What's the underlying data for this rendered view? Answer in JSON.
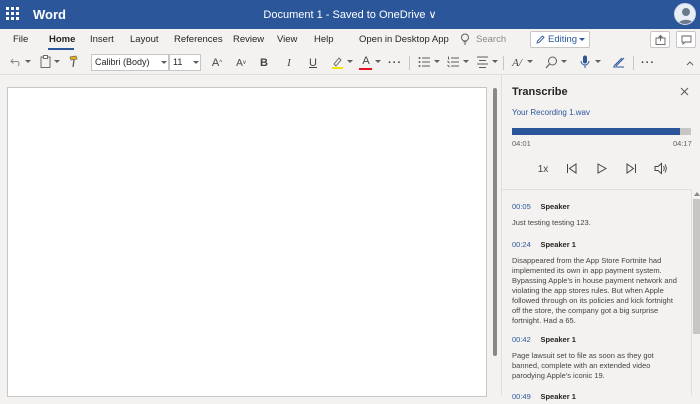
{
  "app": {
    "name": "Word",
    "doc_title": "Document 1 - Saved to OneDrive ∨"
  },
  "menu": {
    "items": [
      "File",
      "Home",
      "Insert",
      "Layout",
      "References",
      "Review",
      "View",
      "Help",
      "Open in Desktop App"
    ],
    "active": "Home",
    "search_label": "Search",
    "editing_label": "Editing"
  },
  "ribbon": {
    "font_name": "Calibri (Body)",
    "font_size": "11",
    "highlight_color": "#f2e600",
    "font_color": "#e81123"
  },
  "transcribe": {
    "title": "Transcribe",
    "file_name": "Your Recording 1.wav",
    "current_time": "04:01",
    "total_time": "04:17",
    "progress": 0.94,
    "speed_label": "1x",
    "entries": [
      {
        "time": "00:05",
        "speaker": "Speaker",
        "text": "Just testing testing 123."
      },
      {
        "time": "00:24",
        "speaker": "Speaker 1",
        "text": "Disappeared from the App Store Fortnite had implemented its own in app payment system. Bypassing Apple's in house payment network and violating the app stores rules. But when Apple followed through on its policies and kick fortnight off the store, the company got a big surprise fortnight. Had a 65."
      },
      {
        "time": "00:42",
        "speaker": "Speaker 1",
        "text": "Page lawsuit set to file as soon as they got banned, complete with an extended video parodying Apple's iconic 19."
      },
      {
        "time": "00:49",
        "speaker": "Speaker 1",
        "text": ""
      }
    ]
  },
  "colors": {
    "brand": "#2b579a",
    "panel_bg": "#f3f2f1"
  },
  "icons": [
    "waffle-icon",
    "avatar",
    "lightbulb-icon",
    "pencil-icon",
    "share-icon",
    "comments-icon",
    "undo-icon",
    "paste-icon",
    "format-painter-icon",
    "grow-font-icon",
    "shrink-font-icon",
    "bold-icon",
    "italic-icon",
    "underline-icon",
    "highlight-icon",
    "font-color-icon",
    "more-icon",
    "bullets-icon",
    "numbering-icon",
    "align-icon",
    "styles-icon",
    "find-icon",
    "dictate-icon",
    "editor-icon",
    "close-icon",
    "rewind-icon",
    "play-icon",
    "forward-icon",
    "volume-icon"
  ]
}
